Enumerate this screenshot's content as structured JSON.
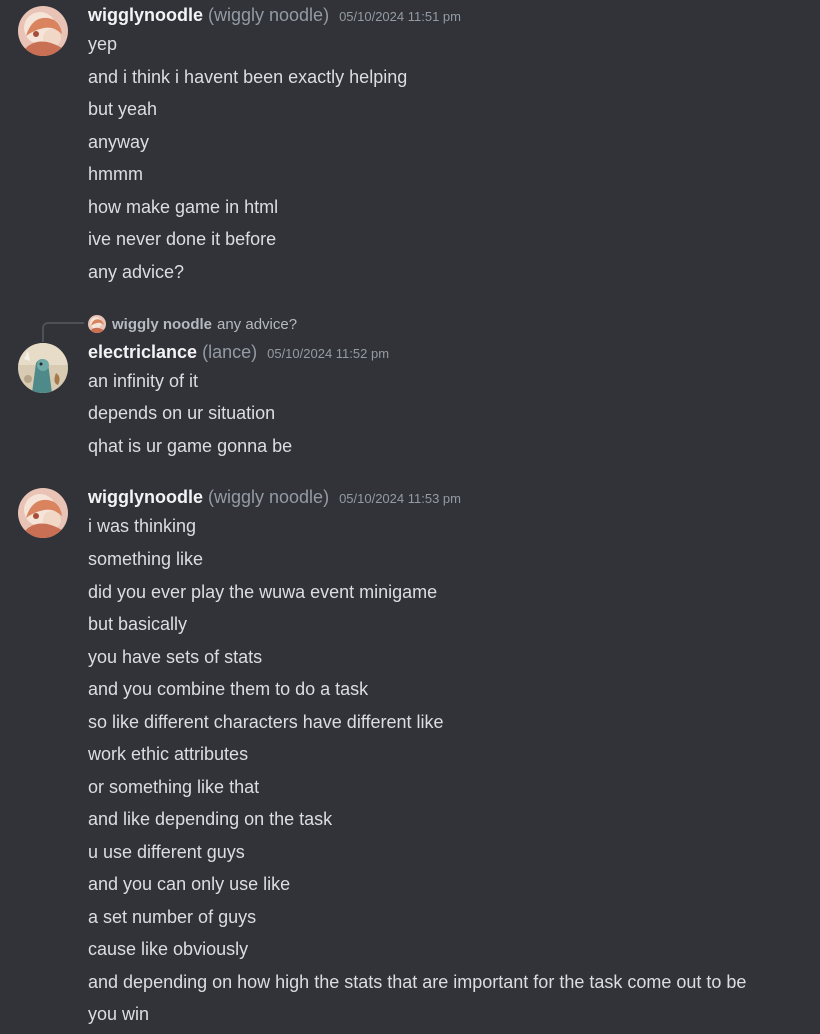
{
  "messages": [
    {
      "username": "wigglynoodle",
      "nickname": "(wiggly noodle)",
      "timestamp": "05/10/2024 11:51 pm",
      "lines": [
        "yep",
        "and i think i havent been exactly helping",
        "but yeah",
        "anyway",
        "hmmm",
        "how make game in html",
        "ive never done it before",
        "any advice?"
      ]
    },
    {
      "reply": {
        "username": "wiggly noodle",
        "text": "any advice?"
      },
      "username": "electriclance",
      "nickname": "(lance)",
      "timestamp": "05/10/2024 11:52 pm",
      "lines": [
        "an infinity of it",
        "depends on ur situation",
        "qhat is ur game gonna be"
      ]
    },
    {
      "username": "wigglynoodle",
      "nickname": "(wiggly noodle)",
      "timestamp": "05/10/2024 11:53 pm",
      "lines": [
        "i was thinking",
        "something like",
        "did you ever play the wuwa event minigame",
        "but basically",
        "you have sets of stats",
        "and you combine them to do a task",
        "so like different characters have different like",
        "work ethic attributes",
        "or something like that",
        "and like depending on the task",
        "u use different guys",
        "and you can only use like",
        "a set number of guys",
        "cause like obviously",
        "and depending on how high the stats that are important for the task come out to be",
        "you win"
      ]
    }
  ],
  "colors": {
    "background": "#313338",
    "username": "#f2f3f5",
    "muted": "#949ba4",
    "text": "#dbdee1"
  }
}
